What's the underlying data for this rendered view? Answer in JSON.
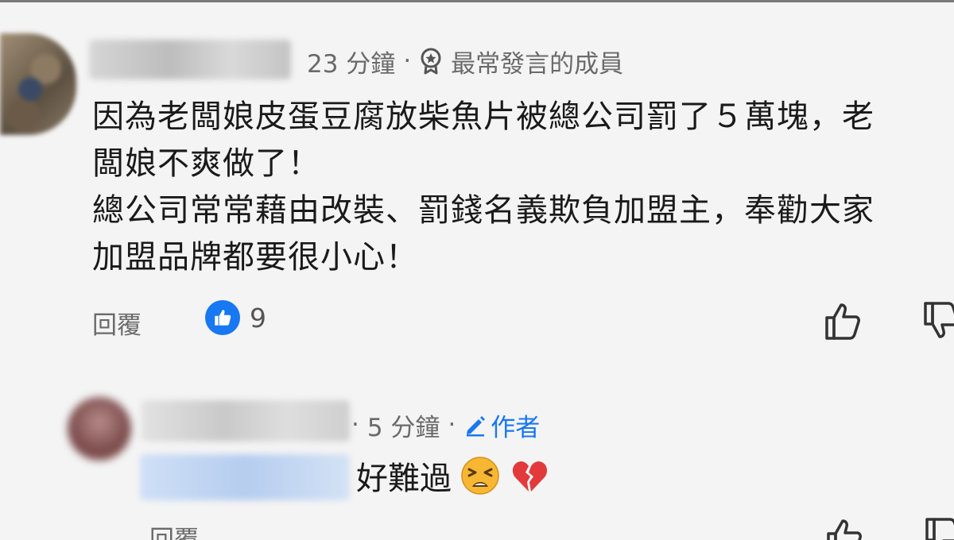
{
  "comment": {
    "time": "23 分鐘",
    "separator": "·",
    "badge_label": "最常發言的成員",
    "lines": [
      "因為老闆娘皮蛋豆腐放柴魚片被總公司罰了５萬塊，老",
      "闆娘不爽做了！",
      "總公司常常藉由改裝、罰錢名義欺負加盟主，奉勸大家",
      "加盟品牌都要很小心！"
    ],
    "reply_label": "回覆",
    "like_count": "9"
  },
  "reply": {
    "time": "5 分鐘",
    "separator": "·",
    "author_label": "作者",
    "text": "好難過",
    "reply_label": "回覆"
  },
  "colors": {
    "accent": "#1877f2",
    "meta_text": "#6a6a6a",
    "heart": "#e23a3a",
    "emoji_face": "#f7b733"
  },
  "icons": {
    "badge": "member-badge-icon",
    "like_reaction": "like-reaction-icon",
    "thumb_up": "thumb-up-icon",
    "thumb_down": "thumb-down-icon",
    "author": "pencil-icon",
    "emoji_1": "tired-face-emoji",
    "emoji_2": "broken-heart-emoji"
  }
}
